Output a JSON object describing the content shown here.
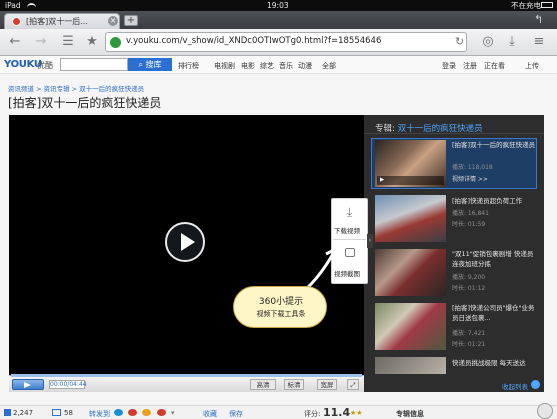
{
  "status_bar": {
    "carrier": "iPad",
    "time": "19:03",
    "battery": "不在充电"
  },
  "tabs": [
    {
      "title": "[拍客]双十一后..."
    }
  ],
  "toolbar": {
    "url": "v.youku.com/v_show/id_XNDc0OTIwOTg0.html?f=18554646"
  },
  "youku_header": {
    "logo": "YOUKU",
    "logo_sub": "优酷",
    "search_button": "搜库",
    "nav": [
      "排行榜",
      "电视剧",
      "电影",
      "综艺",
      "音乐",
      "动漫",
      "全部"
    ],
    "login": "登录",
    "register": "注册",
    "watching": "正在看",
    "upload": "上传"
  },
  "breadcrumb": "资讯频道 > 资讯专辑 > 双十一后的疯狂快递员",
  "page_title": "[拍客]双十一后的疯狂快递员",
  "player": {
    "time": "00:00/04:44",
    "quality": "高清",
    "btn_ratio": "标清",
    "btn_wide": "宽屏"
  },
  "popover": {
    "download": "下载视频",
    "capture": "视频截图"
  },
  "callout": {
    "title": "360小提示",
    "subtitle": "视频下载工具条"
  },
  "playlist": {
    "header_prefix": "专辑:",
    "header_title": "双十一后的疯狂快递员",
    "more": "收起列表",
    "items": [
      {
        "title": "[拍客]双十一后的疯狂快递员",
        "meta1": "播放: 118,018",
        "meta2": "视频详情 >>",
        "active": true
      },
      {
        "title": "[拍客]快递员超负荷工作",
        "meta1": "播放: 16,841",
        "meta2": "时长: 01:59",
        "active": false
      },
      {
        "title": "\"双11\"促销包裹剧增 快递员连夜加班分拣",
        "meta1": "播放: 9,200",
        "meta2": "时长: 01:12",
        "active": false
      },
      {
        "title": "[拍客]快递公司员\"爆仓\"业务员日送包裹...",
        "meta1": "播放: 7,421",
        "meta2": "时长: 01:21",
        "active": false
      },
      {
        "title": "快递员挑战极限 每天送达",
        "meta1": "",
        "meta2": "",
        "active": false
      }
    ]
  },
  "bottom_bar": {
    "plays": "2,247",
    "comments": "58",
    "share": "转发到",
    "rating_label": "评分:",
    "rating": "11.4",
    "favorite": "收藏",
    "save": "保存",
    "album_info": "专辑信息"
  },
  "colors": {
    "accent": "#2c6fd3",
    "link": "#2b6dc9",
    "player_bg": "#000000"
  }
}
